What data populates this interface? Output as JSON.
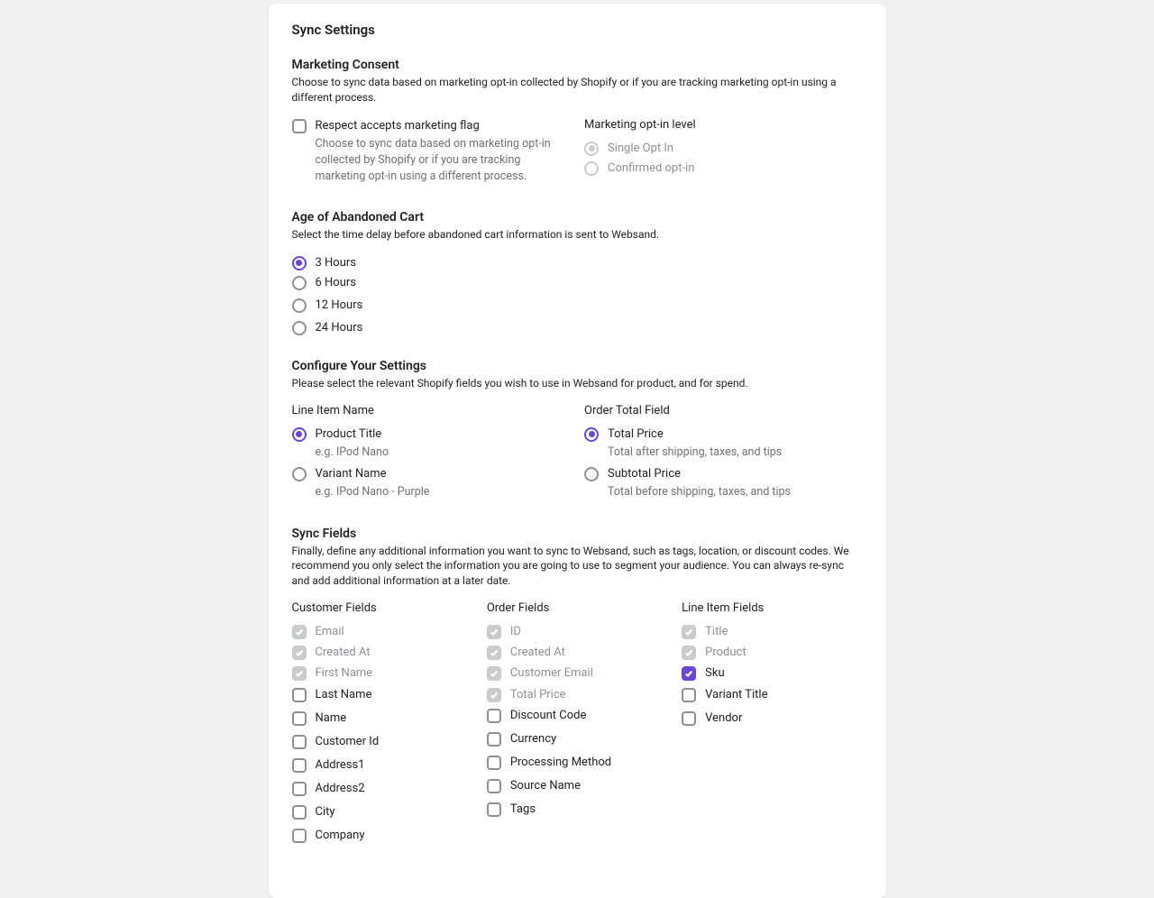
{
  "title": "Sync Settings",
  "marketing": {
    "title": "Marketing Consent",
    "desc": "Choose to sync data based on marketing opt-in collected by Shopify or if you are tracking marketing opt-in using a different process.",
    "respect_label": "Respect accepts marketing flag",
    "respect_help": "Choose to sync data based on marketing opt-in collected by Shopify or if you are tracking marketing opt-in using a different process.",
    "optin_label": "Marketing opt-in level",
    "optin_single": "Single Opt In",
    "optin_confirmed": "Confirmed opt-in"
  },
  "abandoned": {
    "title": "Age of Abandoned Cart",
    "desc": "Select the time delay before abandoned cart information is sent to Websand.",
    "options": [
      "3 Hours",
      "6 Hours",
      "12 Hours",
      "24 Hours"
    ]
  },
  "configure": {
    "title": "Configure Your Settings",
    "desc": "Please select the relevant Shopify fields you wish to use in Websand for product, and for spend.",
    "line_item_label": "Line Item Name",
    "product_title": "Product Title",
    "product_help": "e.g. IPod Nano",
    "variant_name": "Variant Name",
    "variant_help": "e.g. IPod Nano - Purple",
    "order_total_label": "Order Total Field",
    "total_price": "Total Price",
    "total_help": "Total after shipping, taxes, and tips",
    "subtotal_price": "Subtotal Price",
    "subtotal_help": "Total before shipping, taxes, and tips"
  },
  "sync": {
    "title": "Sync Fields",
    "desc": "Finally, define any additional information you want to sync to Websand, such as tags, location, or discount codes. We recommend you only select the information you are going to use to segment your audience. You can always re-sync and add additional information at a later date.",
    "customer_label": "Customer Fields",
    "order_label": "Order Fields",
    "lineitem_label": "Line Item Fields",
    "customer": [
      "Email",
      "Created At",
      "First Name",
      "Last Name",
      "Name",
      "Customer Id",
      "Address1",
      "Address2",
      "City",
      "Company"
    ],
    "order": [
      "ID",
      "Created At",
      "Customer Email",
      "Total Price",
      "Discount Code",
      "Currency",
      "Processing Method",
      "Source Name",
      "Tags"
    ],
    "lineitem": [
      "Title",
      "Product",
      "Sku",
      "Variant Title",
      "Vendor"
    ]
  }
}
